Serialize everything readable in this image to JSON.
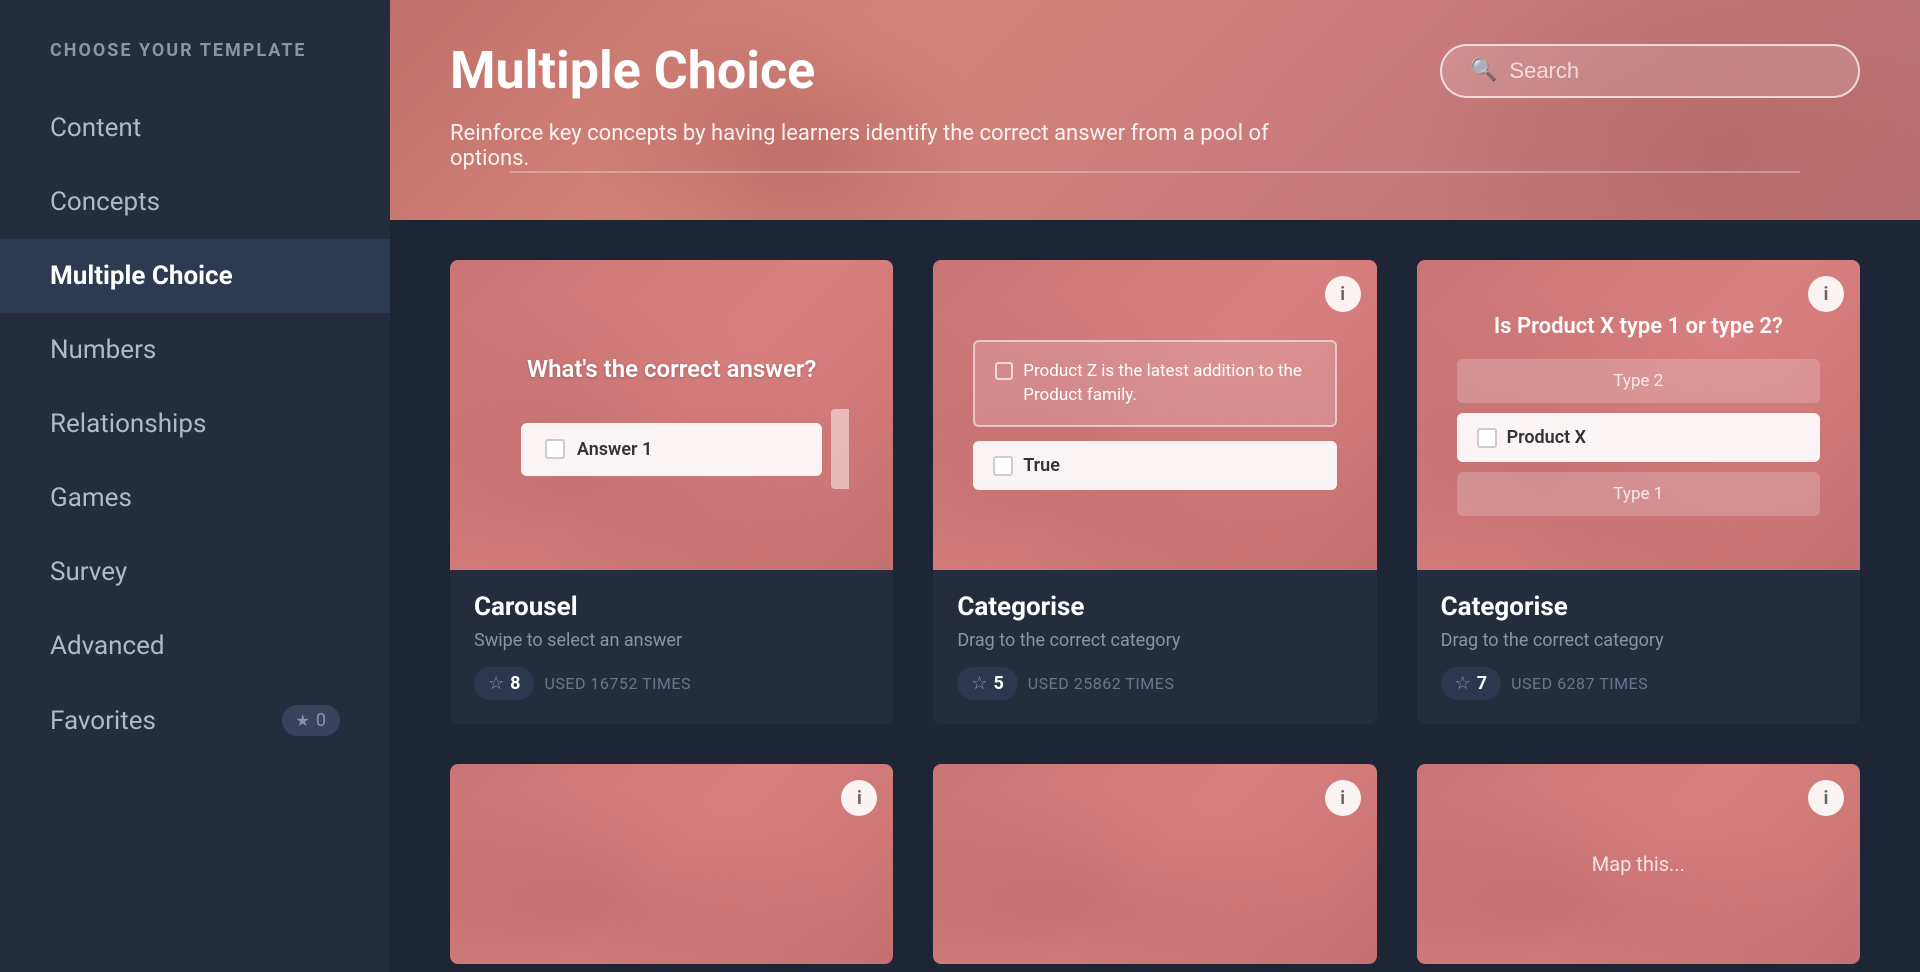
{
  "sidebar": {
    "header": "CHOOSE YOUR TEMPLATE",
    "items": [
      {
        "id": "content",
        "label": "Content",
        "active": false
      },
      {
        "id": "concepts",
        "label": "Concepts",
        "active": false
      },
      {
        "id": "multiple-choice",
        "label": "Multiple Choice",
        "active": true
      },
      {
        "id": "numbers",
        "label": "Numbers",
        "active": false
      },
      {
        "id": "relationships",
        "label": "Relationships",
        "active": false
      },
      {
        "id": "games",
        "label": "Games",
        "active": false
      },
      {
        "id": "survey",
        "label": "Survey",
        "active": false
      },
      {
        "id": "advanced",
        "label": "Advanced",
        "active": false
      },
      {
        "id": "favorites",
        "label": "Favorites",
        "active": false
      }
    ],
    "favorites_count": "0"
  },
  "header": {
    "title": "Multiple Choice",
    "subtitle": "Reinforce key concepts by having learners identify the correct answer from a pool of options.",
    "search_placeholder": "Search"
  },
  "templates": [
    {
      "id": "carousel",
      "title": "Carousel",
      "description": "Swipe to select an answer",
      "rating": "8",
      "used_times": "USED 16752 TIMES",
      "preview_question": "What's the correct answer?",
      "preview_answer": "Answer 1"
    },
    {
      "id": "categorise-1",
      "title": "Categorise",
      "description": "Drag to the correct category",
      "rating": "5",
      "used_times": "USED 25862 TIMES",
      "preview_statement": "Product Z is the latest addition to the Product family.",
      "preview_true": "True"
    },
    {
      "id": "categorise-2",
      "title": "Categorise",
      "description": "Drag to the correct category",
      "rating": "7",
      "used_times": "USED 6287 TIMES",
      "preview_question": "Is Product X type 1 or type 2?",
      "preview_type2": "Type 2",
      "preview_answer": "Product X",
      "preview_type1": "Type 1"
    },
    {
      "id": "bottom-1",
      "title": "",
      "description": "",
      "rating": "",
      "used_times": ""
    },
    {
      "id": "bottom-2",
      "title": "",
      "description": "",
      "rating": "",
      "used_times": ""
    },
    {
      "id": "bottom-3",
      "title": "",
      "description": "",
      "rating": "",
      "used_times": ""
    }
  ],
  "icons": {
    "search": "🔍",
    "star": "☆",
    "star_filled": "★",
    "info": "i"
  }
}
